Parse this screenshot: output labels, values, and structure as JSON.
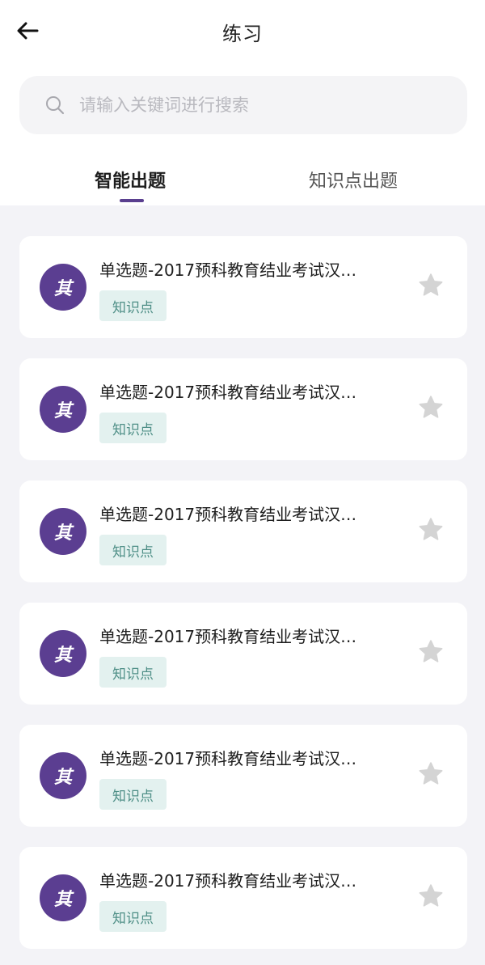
{
  "header": {
    "title": "练习",
    "back_icon": "arrow-left-icon"
  },
  "search": {
    "placeholder": "请输入关键词进行搜索",
    "value": "",
    "icon": "search-icon"
  },
  "tabs": [
    {
      "label": "智能出题",
      "active": true
    },
    {
      "label": "知识点出题",
      "active": false
    }
  ],
  "colors": {
    "accent": "#5b3e91",
    "tag_bg": "#e3f1ef",
    "tag_text": "#4f8f87",
    "star": "#d4d4d4",
    "page_bg": "#f3f3f7"
  },
  "items": [
    {
      "avatar": "其",
      "title": "单选题-2017预科教育结业考试汉…",
      "tag": "知识点",
      "favorite_icon": "star-icon"
    },
    {
      "avatar": "其",
      "title": "单选题-2017预科教育结业考试汉…",
      "tag": "知识点",
      "favorite_icon": "star-icon"
    },
    {
      "avatar": "其",
      "title": "单选题-2017预科教育结业考试汉…",
      "tag": "知识点",
      "favorite_icon": "star-icon"
    },
    {
      "avatar": "其",
      "title": "单选题-2017预科教育结业考试汉…",
      "tag": "知识点",
      "favorite_icon": "star-icon"
    },
    {
      "avatar": "其",
      "title": "单选题-2017预科教育结业考试汉…",
      "tag": "知识点",
      "favorite_icon": "star-icon"
    },
    {
      "avatar": "其",
      "title": "单选题-2017预科教育结业考试汉…",
      "tag": "知识点",
      "favorite_icon": "star-icon"
    }
  ]
}
